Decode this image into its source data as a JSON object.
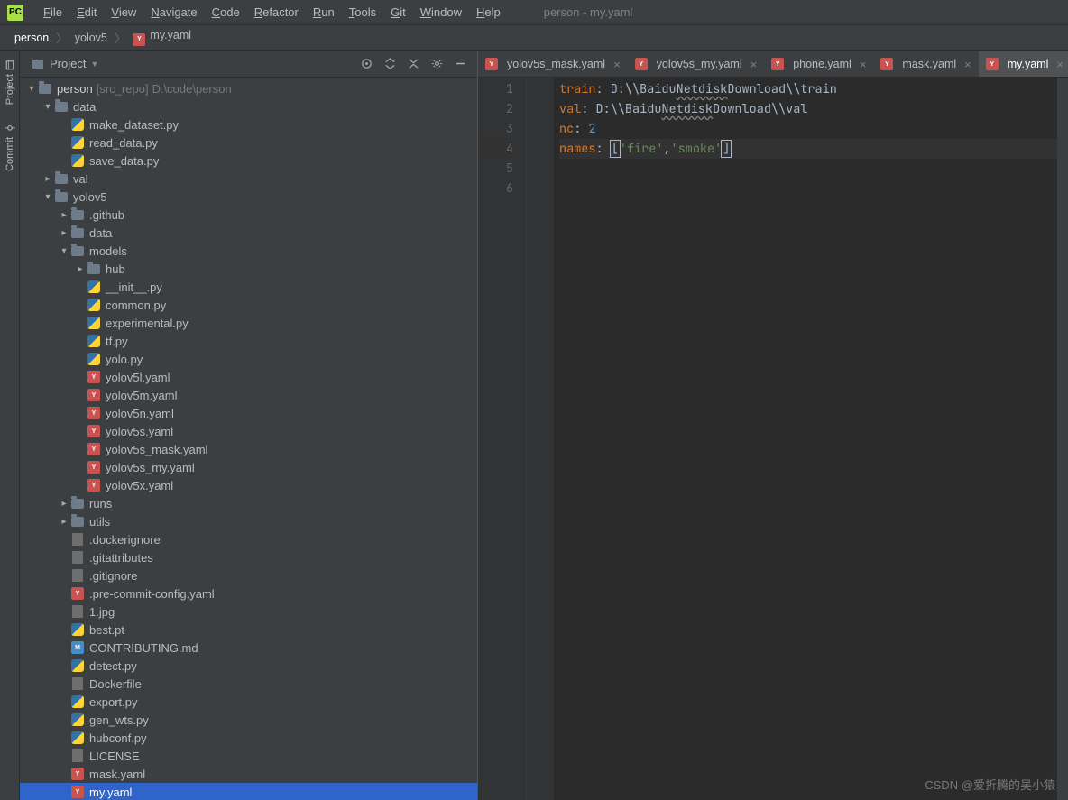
{
  "window": {
    "title": "person - my.yaml"
  },
  "menus": [
    "File",
    "Edit",
    "View",
    "Navigate",
    "Code",
    "Refactor",
    "Run",
    "Tools",
    "Git",
    "Window",
    "Help"
  ],
  "breadcrumbs": [
    {
      "label": "person",
      "icon": null
    },
    {
      "label": "yolov5",
      "icon": null
    },
    {
      "label": "my.yaml",
      "icon": "yaml"
    }
  ],
  "sidebar": {
    "header": {
      "title": "Project"
    },
    "tree": [
      {
        "d": 0,
        "a": "v",
        "ic": "folder",
        "label": "person",
        "suffix": "[src_repo]",
        "path": "D:\\code\\person",
        "bold": true
      },
      {
        "d": 1,
        "a": "v",
        "ic": "folder",
        "label": "data"
      },
      {
        "d": 2,
        "a": " ",
        "ic": "py",
        "label": "make_dataset.py"
      },
      {
        "d": 2,
        "a": " ",
        "ic": "py",
        "label": "read_data.py"
      },
      {
        "d": 2,
        "a": " ",
        "ic": "py",
        "label": "save_data.py"
      },
      {
        "d": 1,
        "a": ">",
        "ic": "folder",
        "label": "val"
      },
      {
        "d": 1,
        "a": "v",
        "ic": "folder",
        "label": "yolov5"
      },
      {
        "d": 2,
        "a": ">",
        "ic": "folder",
        "label": ".github"
      },
      {
        "d": 2,
        "a": ">",
        "ic": "folder",
        "label": "data"
      },
      {
        "d": 2,
        "a": "v",
        "ic": "folder",
        "label": "models"
      },
      {
        "d": 3,
        "a": ">",
        "ic": "folder",
        "label": "hub"
      },
      {
        "d": 3,
        "a": " ",
        "ic": "py",
        "label": "__init__.py"
      },
      {
        "d": 3,
        "a": " ",
        "ic": "py",
        "label": "common.py"
      },
      {
        "d": 3,
        "a": " ",
        "ic": "py",
        "label": "experimental.py"
      },
      {
        "d": 3,
        "a": " ",
        "ic": "py",
        "label": "tf.py"
      },
      {
        "d": 3,
        "a": " ",
        "ic": "py",
        "label": "yolo.py"
      },
      {
        "d": 3,
        "a": " ",
        "ic": "yaml",
        "label": "yolov5l.yaml"
      },
      {
        "d": 3,
        "a": " ",
        "ic": "yaml",
        "label": "yolov5m.yaml"
      },
      {
        "d": 3,
        "a": " ",
        "ic": "yaml",
        "label": "yolov5n.yaml"
      },
      {
        "d": 3,
        "a": " ",
        "ic": "yaml",
        "label": "yolov5s.yaml"
      },
      {
        "d": 3,
        "a": " ",
        "ic": "yaml",
        "label": "yolov5s_mask.yaml"
      },
      {
        "d": 3,
        "a": " ",
        "ic": "yaml",
        "label": "yolov5s_my.yaml"
      },
      {
        "d": 3,
        "a": " ",
        "ic": "yaml",
        "label": "yolov5x.yaml"
      },
      {
        "d": 2,
        "a": ">",
        "ic": "folder",
        "label": "runs"
      },
      {
        "d": 2,
        "a": ">",
        "ic": "folder",
        "label": "utils"
      },
      {
        "d": 2,
        "a": " ",
        "ic": "file",
        "label": ".dockerignore"
      },
      {
        "d": 2,
        "a": " ",
        "ic": "file",
        "label": ".gitattributes"
      },
      {
        "d": 2,
        "a": " ",
        "ic": "file",
        "label": ".gitignore"
      },
      {
        "d": 2,
        "a": " ",
        "ic": "yaml",
        "label": ".pre-commit-config.yaml"
      },
      {
        "d": 2,
        "a": " ",
        "ic": "file",
        "label": "1.jpg"
      },
      {
        "d": 2,
        "a": " ",
        "ic": "py",
        "label": "best.pt"
      },
      {
        "d": 2,
        "a": " ",
        "ic": "md",
        "label": "CONTRIBUTING.md"
      },
      {
        "d": 2,
        "a": " ",
        "ic": "py",
        "label": "detect.py"
      },
      {
        "d": 2,
        "a": " ",
        "ic": "file",
        "label": "Dockerfile"
      },
      {
        "d": 2,
        "a": " ",
        "ic": "py",
        "label": "export.py"
      },
      {
        "d": 2,
        "a": " ",
        "ic": "py",
        "label": "gen_wts.py"
      },
      {
        "d": 2,
        "a": " ",
        "ic": "py",
        "label": "hubconf.py"
      },
      {
        "d": 2,
        "a": " ",
        "ic": "file",
        "label": "LICENSE"
      },
      {
        "d": 2,
        "a": " ",
        "ic": "yaml",
        "label": "mask.yaml"
      },
      {
        "d": 2,
        "a": " ",
        "ic": "yaml",
        "label": "my.yaml",
        "selected": true
      }
    ]
  },
  "rail": {
    "project": "Project",
    "commit": "Commit"
  },
  "tabs": [
    {
      "label": "yolov5s_mask.yaml",
      "active": false
    },
    {
      "label": "yolov5s_my.yaml",
      "active": false
    },
    {
      "label": "phone.yaml",
      "active": false
    },
    {
      "label": "mask.yaml",
      "active": false
    },
    {
      "label": "my.yaml",
      "active": true
    }
  ],
  "code": {
    "lines": [
      1,
      2,
      3,
      4,
      5,
      6
    ],
    "l1": {
      "k": "train",
      "c": ":",
      "v1": " D:\\\\Baidu",
      "v2": "Netdisk",
      "v3": "Download\\\\train"
    },
    "l2": {
      "k": "val",
      "c": ":",
      "v1": " D:\\\\Baidu",
      "v2": "Netdisk",
      "v3": "Download\\\\val"
    },
    "l3": {
      "k": "nc",
      "c": ":",
      "v": " 2"
    },
    "l4": {
      "k": "names",
      "c": ":",
      "sp": " ",
      "lb": "[",
      "s1": "'fire'",
      "cm": ",",
      "s2": "'smoke'",
      "rb": "]"
    }
  },
  "watermark": "CSDN @爱折腾的吴小猿"
}
